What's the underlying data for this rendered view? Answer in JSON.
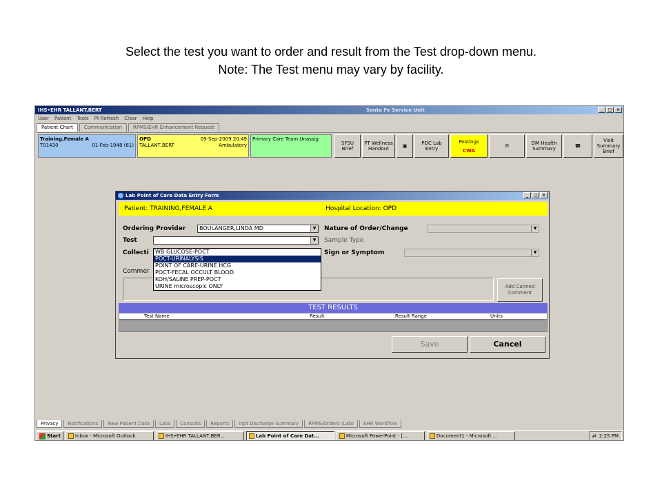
{
  "caption": {
    "line1": "Select the test you want to order and result from the Test drop-down menu.",
    "line2": "Note: The Test menu may vary by facility."
  },
  "app": {
    "title": "IHS•EHR  TALLANT,BERT",
    "center_title": "Santa Fe Service Unit",
    "menu": [
      "User",
      "Patient",
      "Tools",
      "Pt Refresh",
      "Clear",
      "Help"
    ],
    "top_tabs": [
      "Patient Chart",
      "Communication",
      "RPMS/EHR Enhancement Request"
    ],
    "patient": {
      "name": "Training,Female A",
      "id": "T01430",
      "dob": "01-Feb-1948 (61)"
    },
    "visit": {
      "type": "OPD",
      "datetime": "09-Sep-2009 20:49",
      "provider": "TALLANT,BERT",
      "mode": "Ambulatory"
    },
    "team": "Primary Care Team Unassig",
    "toolbar": {
      "sfsu": "SFSU Brief",
      "pt_wellness": "PT Wellness Handout",
      "poc_lab": "POC Lab Entry",
      "postings": "Postings",
      "cwa": "CWA",
      "dm_health": "DM Health Summary",
      "visit_summary": "Visit Summary Brief"
    },
    "bottom_tabs": [
      "Privacy",
      "Notifications",
      "New Patient Data",
      "Labs",
      "Consults",
      "Reports",
      "Inpt Discharge Summary",
      "RPMS/Orders (Lab)",
      "EHR Workflow"
    ]
  },
  "dialog": {
    "title": "Lab Point of Care Data Entry Form",
    "patient_label": "Patient:",
    "patient_value": "TRAINING,FEMALE A",
    "hospital_label": "Hospital Location:",
    "hospital_value": "OPD",
    "ordering_provider_label": "Ordering Provider",
    "ordering_provider_value": "BOULANGER,LINDA MD",
    "test_label": "Test",
    "collection_label": "Collecti",
    "comment_label": "Commer",
    "nature_label": "Nature of Order/Change",
    "sample_type_label": "Sample Type",
    "sign_symptom_label": "Sign or Symptom",
    "test_options": [
      "WB GLUCOSE-POCT",
      "POCT-URINALYSIS",
      "POINT OF CARE-URINE HCG",
      "POCT-FECAL OCCULT BLOOD",
      "KOH/SALINE PREP-POCT",
      "URINE microscopic ONLY"
    ],
    "add_canned_comment": "Add Canned Comment",
    "results_header": "TEST RESULTS",
    "results_columns": [
      "Test Name",
      "Result",
      "Result Range",
      "Units"
    ],
    "save_label": "Save",
    "cancel_label": "Cancel"
  },
  "taskbar": {
    "start": "Start",
    "items": [
      "Inbox - Microsoft Outlook",
      "IHS•EHR  TALLANT,BER...",
      "Lab Point of Care Dat...",
      "Microsoft PowerPoint - [...",
      "Document1 - Microsoft ..."
    ],
    "clock": "2:25 PM"
  }
}
